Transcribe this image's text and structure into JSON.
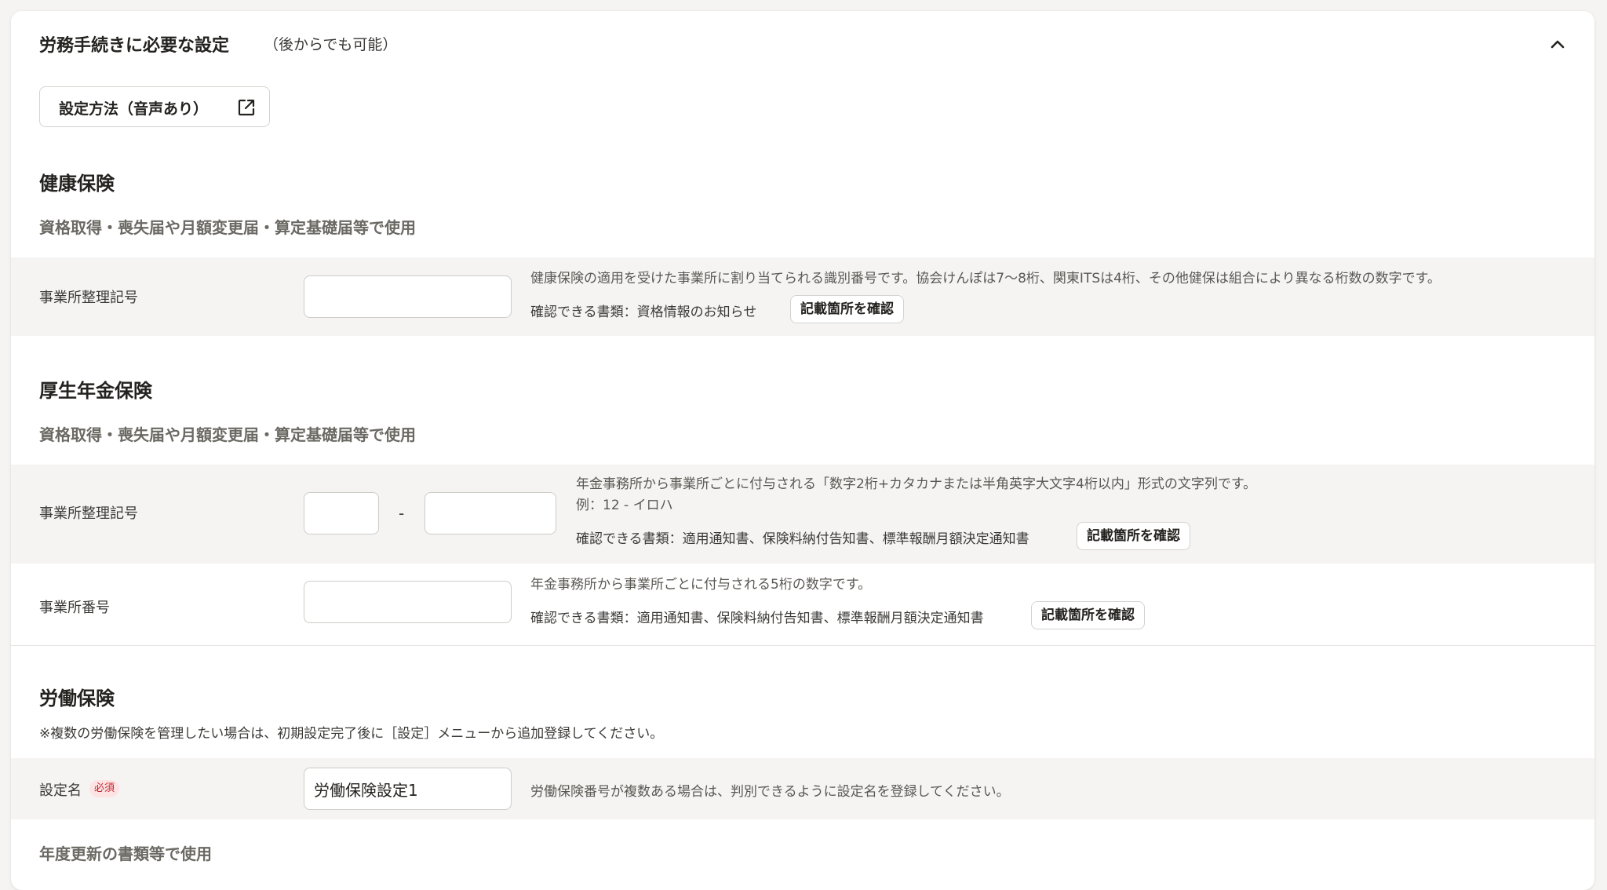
{
  "panel": {
    "title": "労務手続きに必要な設定",
    "subtitle": "（後からでも可能）",
    "collapse_icon": "chevron-up-icon"
  },
  "howto_button": {
    "label": "設定方法（音声あり）",
    "icon": "external-link-icon"
  },
  "health": {
    "title": "健康保険",
    "caption": "資格取得・喪失届や月額変更届・算定基礎届等で使用",
    "office_code": {
      "label": "事業所整理記号",
      "value": "",
      "help": "健康保険の適用を受けた事業所に割り当てられる識別番号です。協会けんぽは7〜8桁、関東ITSは4桁、その他健保は組合により異なる桁数の数字です。",
      "docs": "確認できる書類：資格情報のお知らせ",
      "confirm_label": "記載箇所を確認"
    }
  },
  "pension": {
    "title": "厚生年金保険",
    "caption": "資格取得・喪失届や月額変更届・算定基礎届等で使用",
    "office_code": {
      "label": "事業所整理記号",
      "value_part1": "",
      "value_part2": "",
      "separator": "-",
      "help": "年金事務所から事業所ごとに付与される「数字2桁+カタカナまたは半角英字大文字4桁以内」形式の文字列です。",
      "example": "例：12 - イロハ",
      "docs": "確認できる書類：適用通知書、保険料納付告知書、標準報酬月額決定通知書",
      "confirm_label": "記載箇所を確認"
    },
    "office_number": {
      "label": "事業所番号",
      "value": "",
      "help": "年金事務所から事業所ごとに付与される5桁の数字です。",
      "docs": "確認できる書類：適用通知書、保険料納付告知書、標準報酬月額決定通知書",
      "confirm_label": "記載箇所を確認"
    }
  },
  "labor": {
    "title": "労働保険",
    "note": "※複数の労働保険を管理したい場合は、初期設定完了後に［設定］メニューから追加登録してください。",
    "setting_name": {
      "label": "設定名",
      "required_badge": "必須",
      "value": "労働保険設定1",
      "help": "労働保険番号が複数ある場合は、判別できるように設定名を登録してください。"
    },
    "caption": "年度更新の書類等で使用"
  },
  "colors": {
    "row_bg": "#f5f4f3",
    "required_bg": "#fde3e3",
    "required_text": "#c0262d"
  }
}
